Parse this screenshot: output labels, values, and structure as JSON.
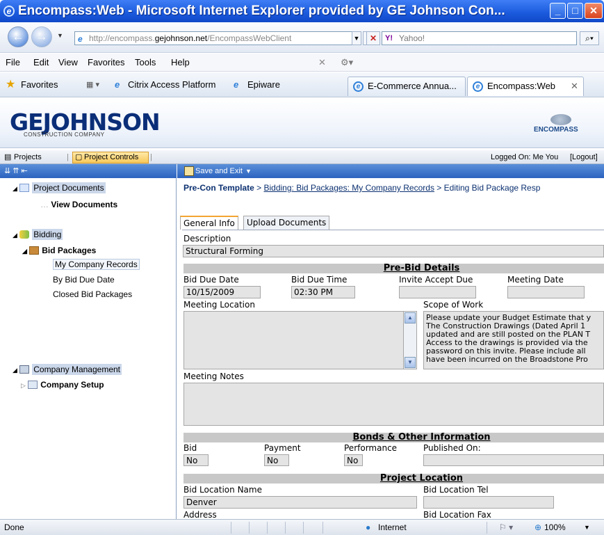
{
  "window": {
    "title": "Encompass:Web - Microsoft Internet Explorer provided by GE Johnson Con..."
  },
  "address": {
    "url_prefix": "http://encompass.",
    "url_domain": "gejohnson.net",
    "url_path": "/EncompassWebClient",
    "search_placeholder": "Yahoo!"
  },
  "menu": [
    "File",
    "Edit",
    "View",
    "Favorites",
    "Tools",
    "Help"
  ],
  "favorites": {
    "label": "Favorites",
    "links": [
      "Citrix Access Platform",
      "Epiware"
    ]
  },
  "tabs": [
    "E-Commerce Annua...",
    "Encompass:Web"
  ],
  "brand": {
    "logo": "GEJOHNSON",
    "logo_sub": "CONSTRUCTION COMPANY",
    "product": "ENCOMPASS"
  },
  "appnav": {
    "projects": "Projects",
    "project_controls": "Project Controls",
    "logged_on": "Logged On: Me You",
    "logout": "[Logout]"
  },
  "toolbar": {
    "save_exit": "Save and Exit"
  },
  "tree": {
    "project_documents": "Project Documents",
    "view_documents": "View Documents",
    "bidding": "Bidding",
    "bid_packages": "Bid Packages",
    "my_company_records": "My Company Records",
    "by_bid_due_date": "By Bid Due Date",
    "closed_bid_packages": "Closed Bid Packages",
    "company_management": "Company Management",
    "company_setup": "Company Setup"
  },
  "breadcrumb": {
    "root": "Pre-Con Template",
    "link": "Bidding: Bid Packages: My Company Records",
    "current": "Editing Bid Package Resp",
    "sep": ">"
  },
  "form_tabs": [
    "General Info",
    "Upload Documents"
  ],
  "form": {
    "description_label": "Description",
    "description": "Structural Forming",
    "prebid_title": "Pre-Bid Details",
    "bid_due_date_label": "Bid Due Date",
    "bid_due_date": "10/15/2009",
    "bid_due_time_label": "Bid Due Time",
    "bid_due_time": "02:30 PM",
    "invite_accept_due_label": "Invite Accept Due",
    "meeting_date_label": "Meeting Date",
    "meeting_location_label": "Meeting Location",
    "scope_label": "Scope of Work",
    "scope_text": "Please update your Budget Estimate that y\nThe Construction Drawings (Dated April 1\nupdated and are still posted on the PLAN T\nAccess to the drawings is provided via the\npassword on this invite. Please include all \nhave been incurred on the Broadstone Pro",
    "meeting_notes_label": "Meeting Notes",
    "bonds_title": "Bonds & Other Information",
    "bid_label": "Bid",
    "bid": "No",
    "payment_label": "Payment",
    "payment": "No",
    "performance_label": "Performance",
    "performance": "No",
    "published_on_label": "Published On:",
    "project_location_title": "Project Location",
    "bid_location_name_label": "Bid Location Name",
    "bid_location_name": "Denver",
    "bid_location_tel_label": "Bid Location Tel",
    "address_label": "Address",
    "bid_location_fax_label": "Bid Location Fax"
  },
  "status": {
    "text": "Done",
    "zone": "Internet",
    "zoom": "100%"
  }
}
